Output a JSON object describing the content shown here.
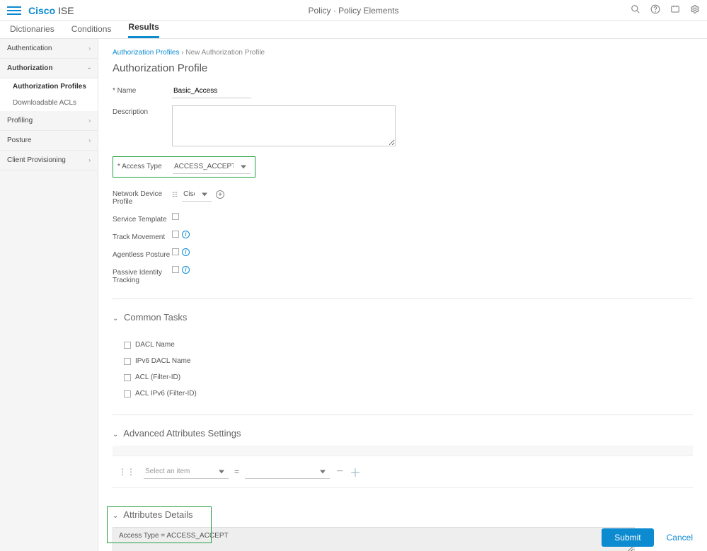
{
  "brand": {
    "cisco": "Cisco",
    "ise": "ISE"
  },
  "breadcrumb_top": "Policy · Policy Elements",
  "tabs": {
    "dictionaries": "Dictionaries",
    "conditions": "Conditions",
    "results": "Results"
  },
  "sidebar": {
    "authentication": "Authentication",
    "authorization": "Authorization",
    "auth_profiles": "Authorization Profiles",
    "dacls": "Downloadable ACLs",
    "profiling": "Profiling",
    "posture": "Posture",
    "client_prov": "Client Provisioning"
  },
  "crumbs": {
    "link": "Authorization Profiles",
    "current": "New Authorization Profile"
  },
  "page_title": "Authorization Profile",
  "form": {
    "name_label": "Name",
    "name_value": "Basic_Access",
    "desc_label": "Description",
    "desc_value": "",
    "access_type_label": "Access Type",
    "access_type_value": "ACCESS_ACCEPT",
    "ndp_label": "Network Device Profile",
    "ndp_value": "Cisco",
    "service_template": "Service Template",
    "track_movement": "Track Movement",
    "agentless_posture": "Agentless Posture",
    "passive_identity": "Passive Identity Tracking"
  },
  "sections": {
    "common_tasks": "Common Tasks",
    "advanced": "Advanced Attributes Settings",
    "attrib_details": "Attributes Details"
  },
  "common_tasks": {
    "dacl": "DACL Name",
    "ipv6dacl": "IPv6 DACL Name",
    "acl": "ACL  (Filter-ID)",
    "aclv6": "ACL IPv6 (Filter-ID)"
  },
  "advanced": {
    "select_placeholder": "Select an item"
  },
  "attrib_details_text": "Access Type = ACCESS_ACCEPT",
  "buttons": {
    "submit": "Submit",
    "cancel": "Cancel"
  }
}
